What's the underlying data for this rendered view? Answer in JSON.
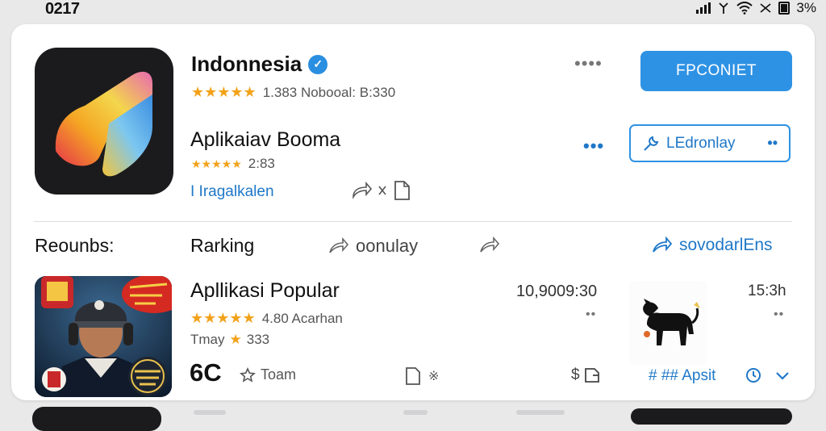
{
  "status_bar": {
    "time": "0217",
    "battery": "3%"
  },
  "featured": {
    "title": "Indonnesia",
    "rating_stars": "★★★★★",
    "rating_info": "1.383 Nobooal: B:330",
    "primary_button": "FPCONIET",
    "more_dots": "••••"
  },
  "second_app": {
    "title": "Aplikaiav Booma",
    "rating_stars": "★★★★★",
    "rating_info": "2:83",
    "link": "I Iragalkalen",
    "more_dots": "•••",
    "outline_button": "LEdronlay",
    "outline_more": "••"
  },
  "section": {
    "left_heading": "Reounbs:",
    "ranking_heading": "Rarking",
    "popular_label": "oonulay",
    "right_link": "sovodarlEns"
  },
  "popular_app": {
    "title": "Apllikasi Popular",
    "rating_stars": "★★★★★",
    "rating_info": "4.80 Acarhan",
    "tray_label": "Tmay",
    "tray_star": "★",
    "tray_value": "333",
    "big_count": "6C",
    "team_label": "Toam",
    "hash_label": "※",
    "count_right": "10,9009:30",
    "more_dots_mid": "••",
    "dollar_label": "$",
    "time_right": "15:3h",
    "more_dots_right": "••",
    "hash_apsit": "# ## Apsit"
  },
  "colors": {
    "accent_blue": "#2e92e4",
    "link_blue": "#1f78c8",
    "star_orange": "#f2a21a",
    "icon_dark": "#1b1b1d"
  }
}
